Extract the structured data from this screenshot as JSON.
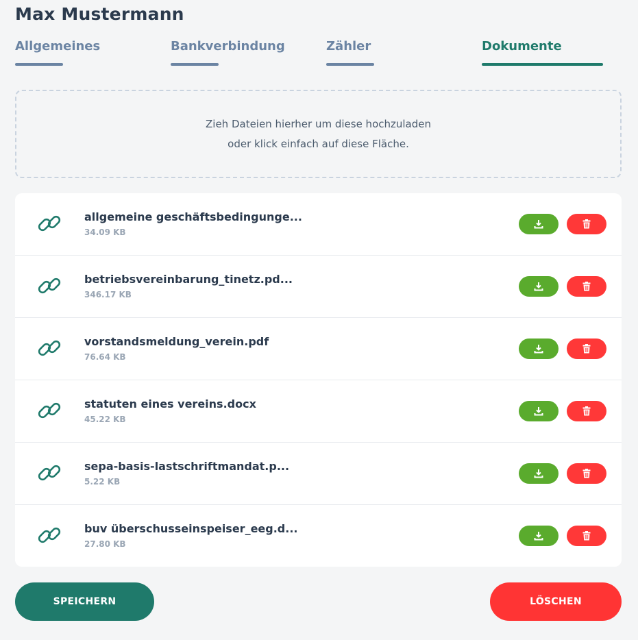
{
  "header": {
    "title": "Max Mustermann"
  },
  "tabs": [
    {
      "label": "Allgemeines",
      "active": false
    },
    {
      "label": "Bankverbindung",
      "active": false
    },
    {
      "label": "Zähler",
      "active": false
    },
    {
      "label": "Dokumente",
      "active": true
    }
  ],
  "dropzone": {
    "line1": "Zieh Dateien hierher um diese hochzuladen",
    "line2": "oder klick einfach auf diese Fläche."
  },
  "files": [
    {
      "name": "allgemeine geschäftsbedingunge...",
      "size": "34.09 KB"
    },
    {
      "name": "betriebsvereinbarung_tinetz.pd...",
      "size": "346.17 KB"
    },
    {
      "name": "vorstandsmeldung_verein.pdf",
      "size": "76.64 KB"
    },
    {
      "name": "statuten eines vereins.docx",
      "size": "45.22 KB"
    },
    {
      "name": "sepa-basis-lastschriftmandat.p...",
      "size": "5.22 KB"
    },
    {
      "name": "buv überschusseinspeiser_eeg.d...",
      "size": "27.80 KB"
    }
  ],
  "icons": {
    "file": "link-icon",
    "download": "download-icon",
    "delete": "trash-icon"
  },
  "actions": {
    "save_label": "SPEICHERN",
    "delete_label": "LÖSCHEN"
  },
  "colors": {
    "primary": "#1f7a6b",
    "tab_inactive": "#6b84a3",
    "download": "#5aab2d",
    "delete": "#ff3838"
  }
}
